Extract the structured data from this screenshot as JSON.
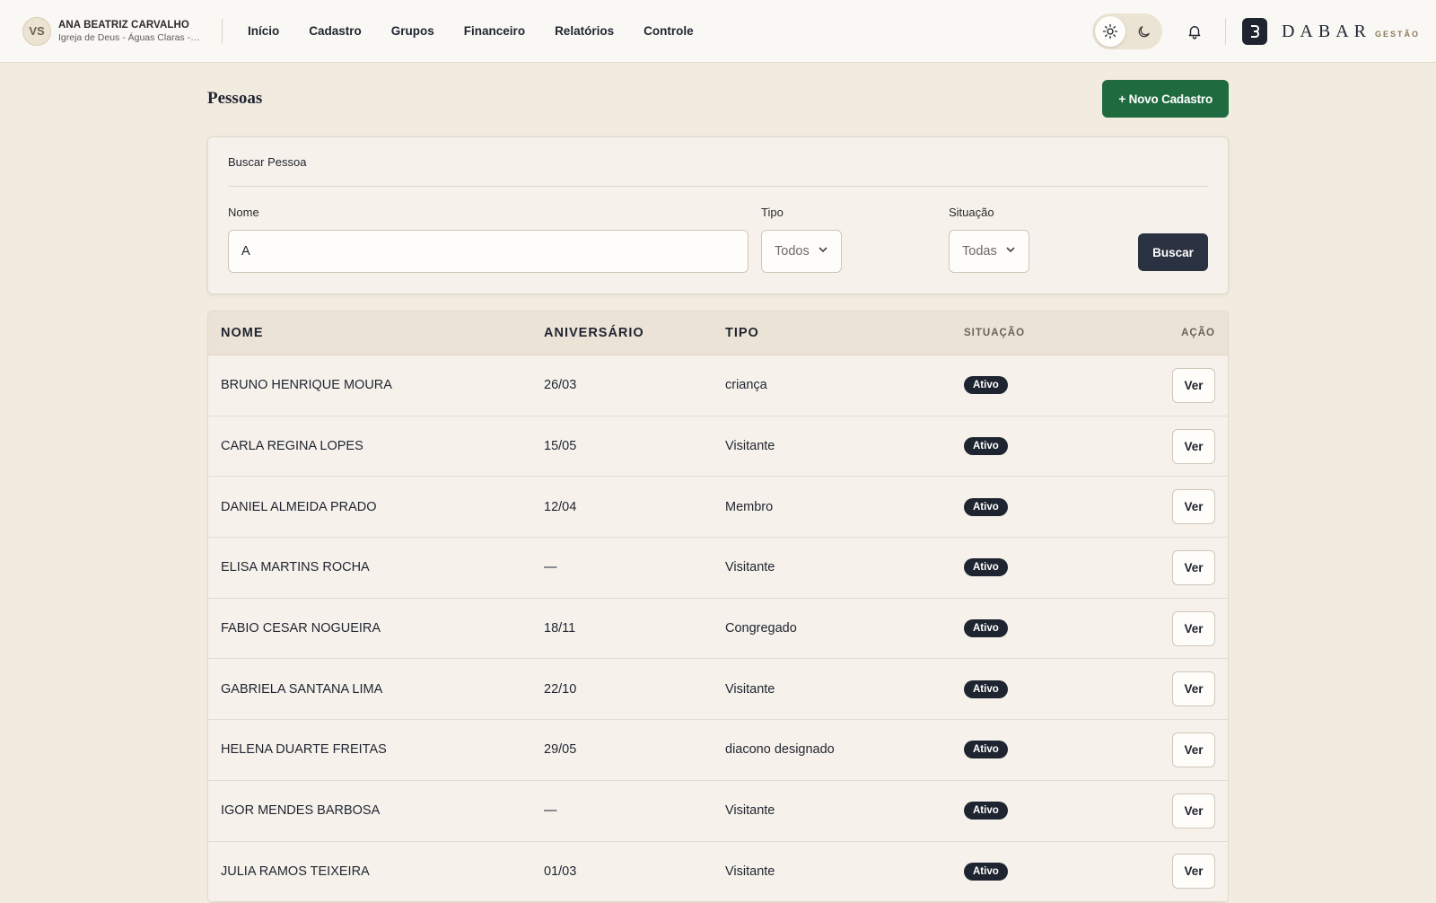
{
  "user": {
    "initials": "VS",
    "name": "ANA BEATRIZ CARVALHO",
    "organization": "Igreja de Deus - Águas Claras - I..."
  },
  "nav": {
    "items": [
      "Início",
      "Cadastro",
      "Grupos",
      "Financeiro",
      "Relatórios",
      "Controle"
    ]
  },
  "brand": {
    "name": "DABAR",
    "subtitle": "GESTÃO"
  },
  "icons": {
    "theme_light": "sun-icon",
    "theme_dark": "moon-icon",
    "notifications": "bell-icon",
    "select_arrow": "chevron-down-icon"
  },
  "page": {
    "title": "Pessoas",
    "new_button": "+ Novo Cadastro"
  },
  "search": {
    "title": "Buscar Pessoa",
    "name_label": "Nome",
    "name_value": "A",
    "type_label": "Tipo",
    "type_value": "Todos",
    "status_label": "Situação",
    "status_value": "Todas",
    "button": "Buscar"
  },
  "table": {
    "headers": [
      "NOME",
      "ANIVERSÁRIO",
      "TIPO",
      "SITUAÇÃO",
      "AÇÃO"
    ],
    "action_label": "Ver",
    "rows": [
      {
        "name": "BRUNO HENRIQUE MOURA",
        "birthday": "26/03",
        "type": "criança",
        "status": "Ativo"
      },
      {
        "name": "CARLA REGINA LOPES",
        "birthday": "15/05",
        "type": "Visitante",
        "status": "Ativo"
      },
      {
        "name": "DANIEL ALMEIDA PRADO",
        "birthday": "12/04",
        "type": "Membro",
        "status": "Ativo"
      },
      {
        "name": "ELISA MARTINS ROCHA",
        "birthday": "—",
        "type": "Visitante",
        "status": "Ativo"
      },
      {
        "name": "FABIO CESAR NOGUEIRA",
        "birthday": "18/11",
        "type": "Congregado",
        "status": "Ativo"
      },
      {
        "name": "GABRIELA SANTANA LIMA",
        "birthday": "22/10",
        "type": "Visitante",
        "status": "Ativo"
      },
      {
        "name": "HELENA DUARTE FREITAS",
        "birthday": "29/05",
        "type": "diacono designado",
        "status": "Ativo"
      },
      {
        "name": "IGOR MENDES BARBOSA",
        "birthday": "—",
        "type": "Visitante",
        "status": "Ativo"
      },
      {
        "name": "JULIA RAMOS TEIXEIRA",
        "birthday": "01/03",
        "type": "Visitante",
        "status": "Ativo"
      }
    ]
  },
  "colors": {
    "page_bg": "#f1ebe0",
    "primary_green": "#1f6b3f",
    "dark": "#1e2530"
  }
}
